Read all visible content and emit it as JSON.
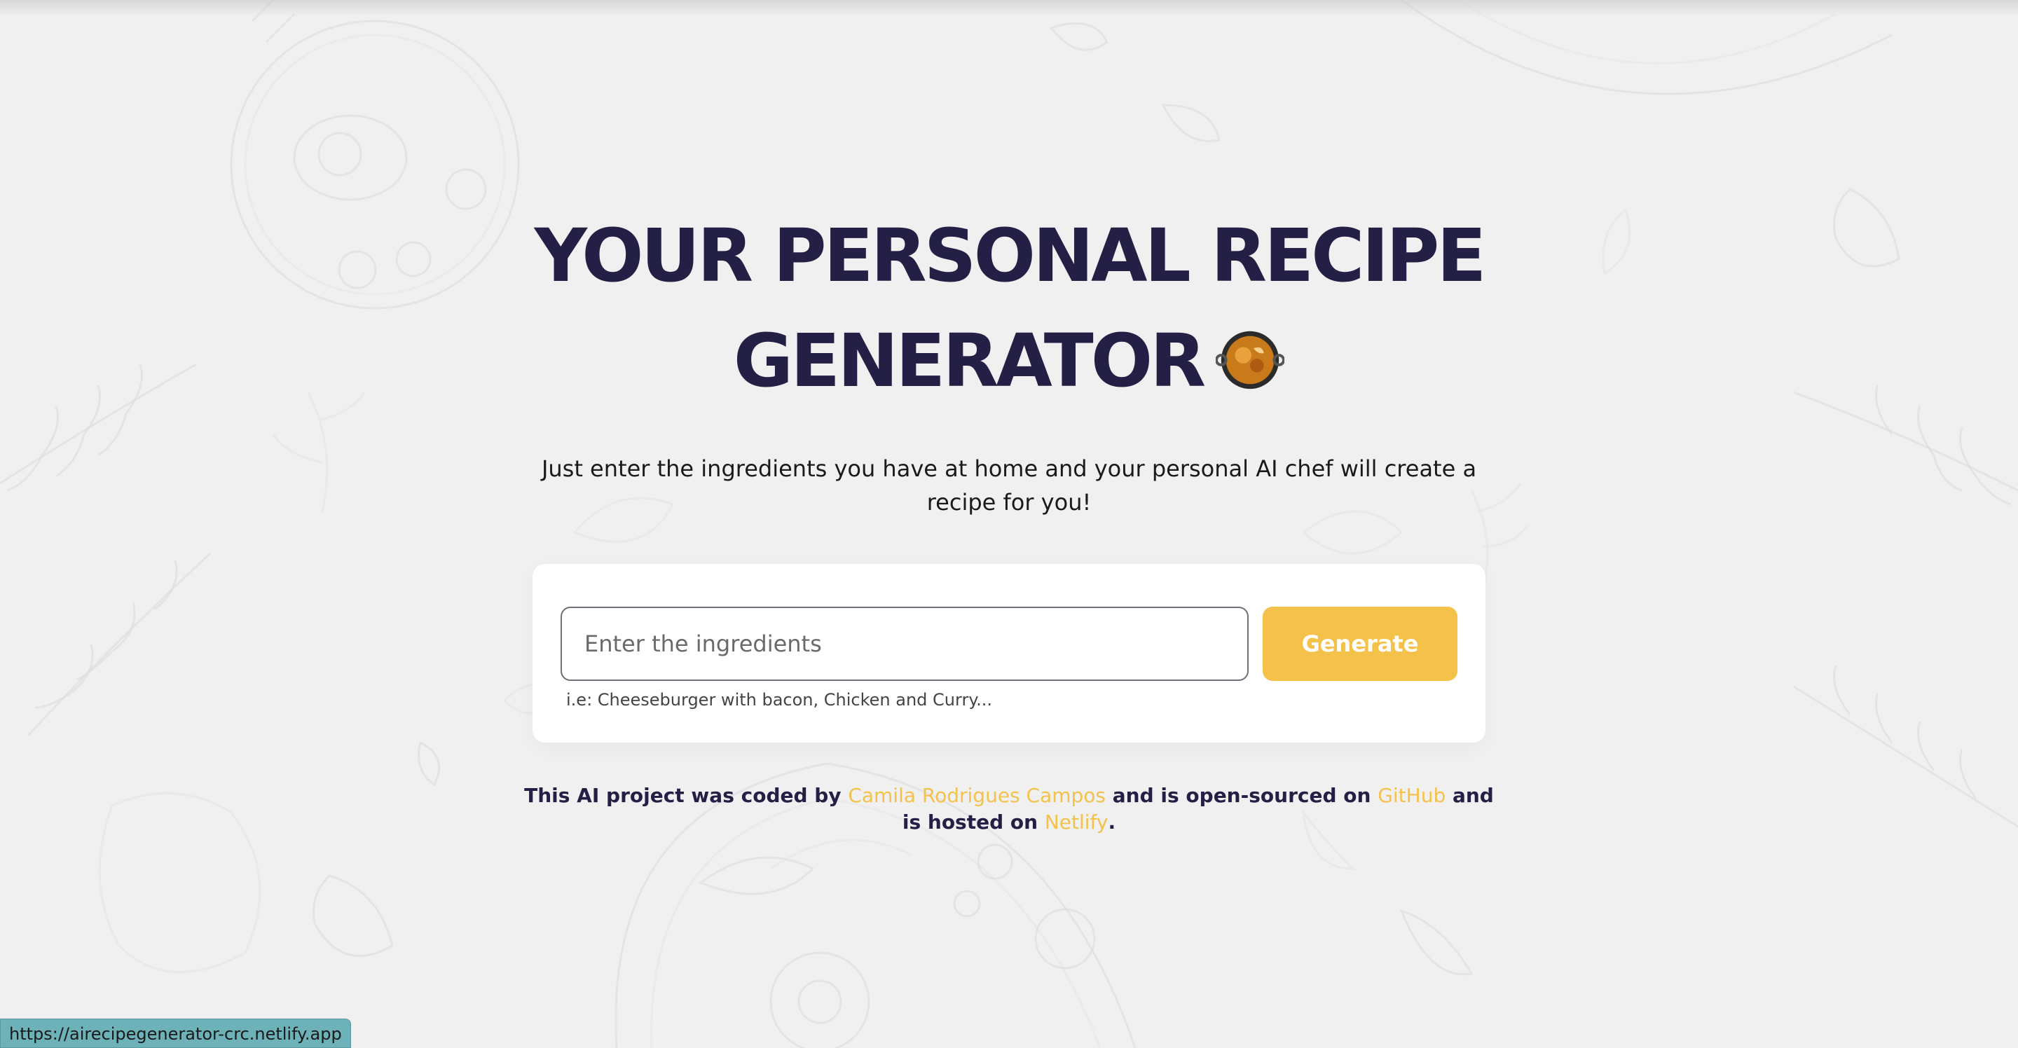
{
  "hero": {
    "title": "YOUR PERSONAL RECIPE GENERATOR",
    "icon": "paella-pan-emoji"
  },
  "subtitle": "Just enter the ingredients you have at home and your personal AI chef will create a recipe for you!",
  "form": {
    "input_placeholder": "Enter the ingredients",
    "input_value": "",
    "generate_label": "Generate",
    "hint": "i.e: Cheeseburger with bacon, Chicken and Curry..."
  },
  "credits": {
    "part1": "This AI project was coded by ",
    "author": "Camila Rodrigues Campos",
    "part2": " and is open-sourced on ",
    "github": "GitHub",
    "part3": " and is hosted on ",
    "netlify": "Netlify",
    "part4": "."
  },
  "status_bar": {
    "url": "https://airecipegenerator-crc.netlify.app"
  },
  "colors": {
    "background": "#f0f0f1",
    "title": "#241f45",
    "accent": "#f4c24b",
    "card": "#ffffff"
  }
}
